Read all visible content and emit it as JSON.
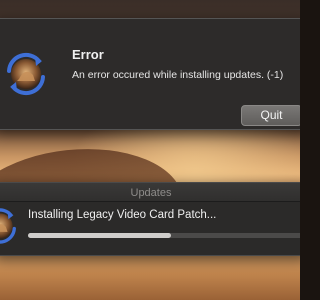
{
  "error_dialog": {
    "icon": "macos-installer-refresh-icon",
    "title": "Error",
    "message": "An error occured while installing updates. (-1)",
    "quit_label": "Quit"
  },
  "updates_window": {
    "title": "Updates",
    "icon": "macos-installer-refresh-icon",
    "status": "Installing Legacy Video Card Patch...",
    "progress": 0.52
  },
  "colors": {
    "dialog_bg": "#2d2b2a",
    "button": "#6c6a68",
    "progress_fill": "#cfcdcb",
    "progress_track": "#4b4a49",
    "icon_arrow": "#3e6fd6"
  }
}
